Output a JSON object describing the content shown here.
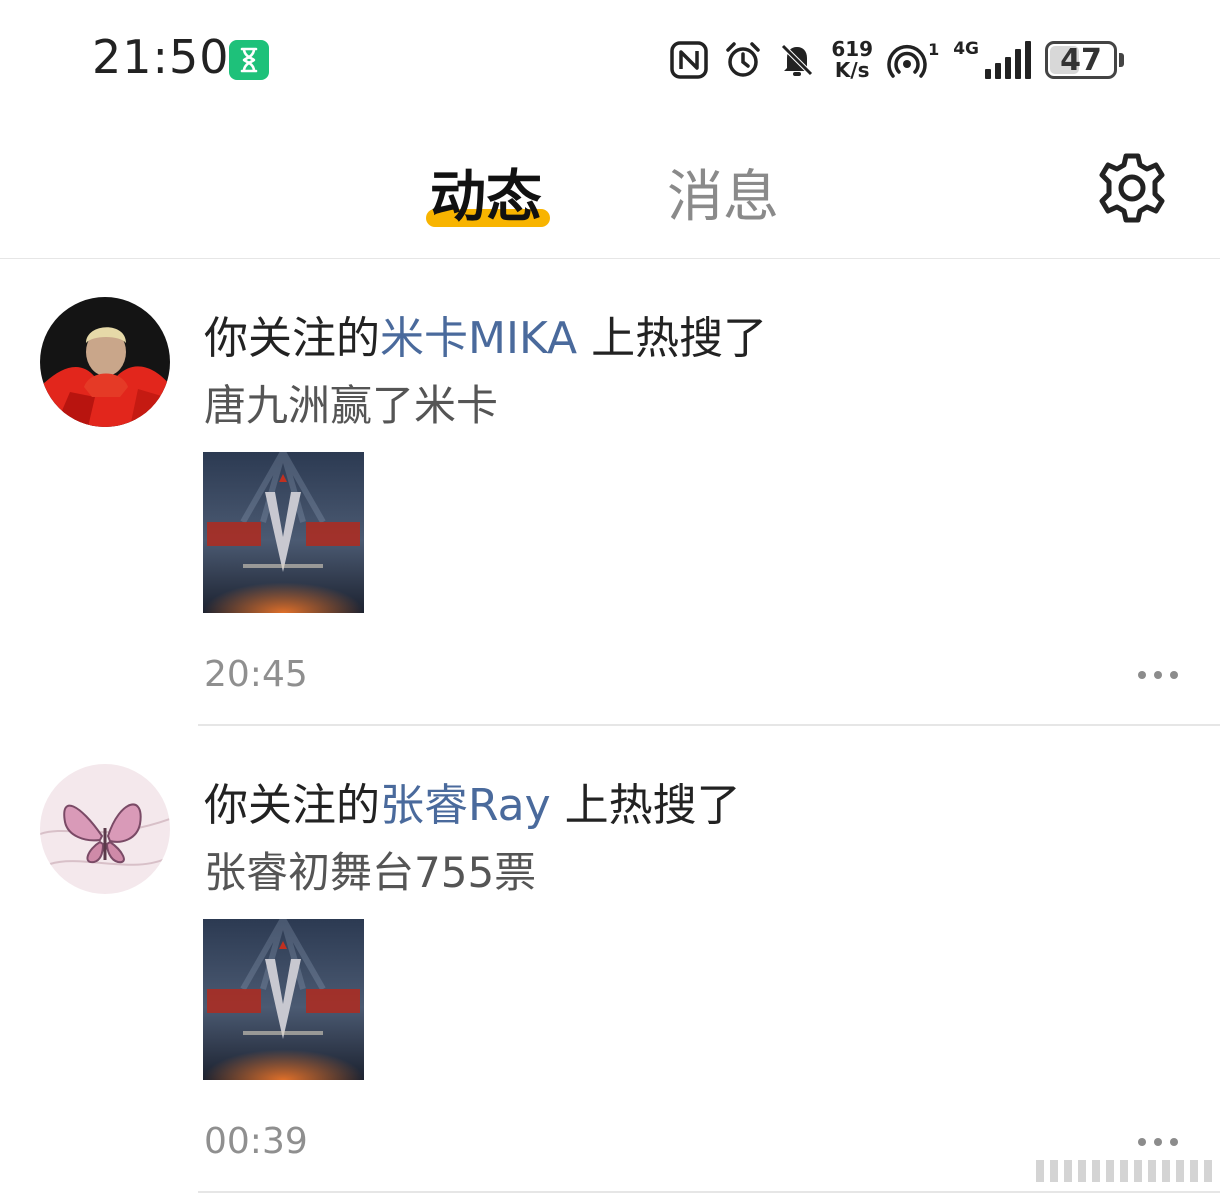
{
  "status_bar": {
    "time": "21:50",
    "net_speed_value": "619",
    "net_speed_unit": "K/s",
    "hotspot_count": "1",
    "network_type": "4G",
    "battery": "47",
    "battery_level_percent": 47,
    "icons": [
      "hourglass-icon",
      "nfc-icon",
      "alarm-icon",
      "mute-icon",
      "hotspot-icon",
      "signal-icon",
      "battery-icon"
    ]
  },
  "tabs": [
    {
      "label": "动态",
      "active": true
    },
    {
      "label": "消息",
      "active": false
    }
  ],
  "settings_icon": "gear-icon",
  "feed": [
    {
      "prefix": "你关注的",
      "name": "米卡MIKA",
      "suffix": " 上热搜了",
      "detail": "唐九洲赢了米卡",
      "time": "20:45"
    },
    {
      "prefix": "你关注的",
      "name": "张睿Ray",
      "suffix": " 上热搜了",
      "detail": "张睿初舞台755票",
      "time": "00:39"
    }
  ],
  "colors": {
    "accent_underline": "#f8b400",
    "name_link": "#4a6a9c",
    "hourglass_badge": "#1ec17a"
  }
}
